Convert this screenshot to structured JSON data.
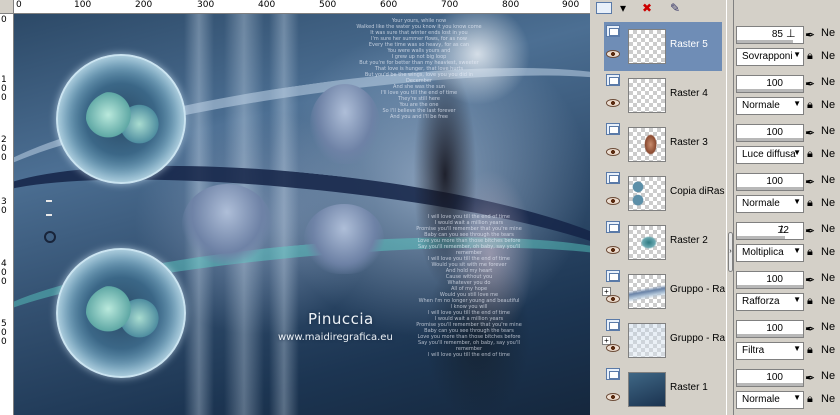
{
  "ruler": {
    "top_labels": [
      "0",
      "100",
      "200",
      "300",
      "400",
      "500",
      "600",
      "700",
      "800",
      "900"
    ],
    "left_labels": [
      "0",
      "1",
      "0",
      "0",
      "2",
      "0",
      "0",
      "3",
      "0",
      "4",
      "0",
      "0",
      "5",
      "0",
      "0"
    ]
  },
  "artwork": {
    "signature": "Pinuccia",
    "url": "www.maidiregrafica.eu",
    "poem_top": "Your yours, while now\nWalked like the water you know it you know come\nIt was sure that winter ends lost in you\nI'm sure her summer flows, for as now\nEvery the time was so heavy, for as can\nYou were walls yours and\nI grew up not big loop\nBut you're for better than my heaviest, sweeter\nThat love is hunger, that love hurts\nBut you'd be the wings, love you you did in December\nAnd she was the sun\nI'll love you till the end of time\nThey're still here\nYou are the one\nSo I'll believe the last forever\nAnd you and I'll be free",
    "poem_lower": "I will love you till the end of time\nI would wait a million years\nPromise you'll remember that you're mine\nBaby can you see through the tears\nLove you more than those bitches before\nSay you'll remember, oh baby, say you'll remember\nI will love you till the end of time\nWould you sit with me forever\nAnd hold my heart\nCause without you\nWhatever you do\nAll of my hope\nWould you still love me\nWhen I'm no longer young and beautiful\nI know you will\nI will love you till the end of time\nI would wait a million years\nPromise you'll remember that you're mine\nBaby can you see through the tears\nLove you more than those bitches before\nSay you'll remember, oh baby, say you'll remember\nI will love you till the end of time"
  },
  "layers": [
    {
      "name": "Raster 5",
      "selected": true,
      "opacity": "85",
      "blend": "Sovrapponi"
    },
    {
      "name": "Raster 4",
      "selected": false,
      "opacity": "100",
      "blend": "Normale"
    },
    {
      "name": "Raster 3",
      "selected": false,
      "opacity": "100",
      "blend": "Luce diffusa"
    },
    {
      "name": "Copia diRas",
      "selected": false,
      "opacity": "100",
      "blend": "Normale"
    },
    {
      "name": "Raster 2",
      "selected": false,
      "opacity": "72",
      "blend": "Moltiplica"
    },
    {
      "name": "Gruppo - Ra",
      "selected": false,
      "opacity": "100",
      "blend": "Rafforza"
    },
    {
      "name": "Gruppo - Ra",
      "selected": false,
      "opacity": "100",
      "blend": "Filtra"
    },
    {
      "name": "Raster 1",
      "selected": false,
      "opacity": "100",
      "blend": "Normale"
    }
  ],
  "props": {
    "link_label": "Ne"
  },
  "icons": {
    "pen": "pen-icon",
    "lock": "lock-icon",
    "eye": "eye-icon"
  }
}
